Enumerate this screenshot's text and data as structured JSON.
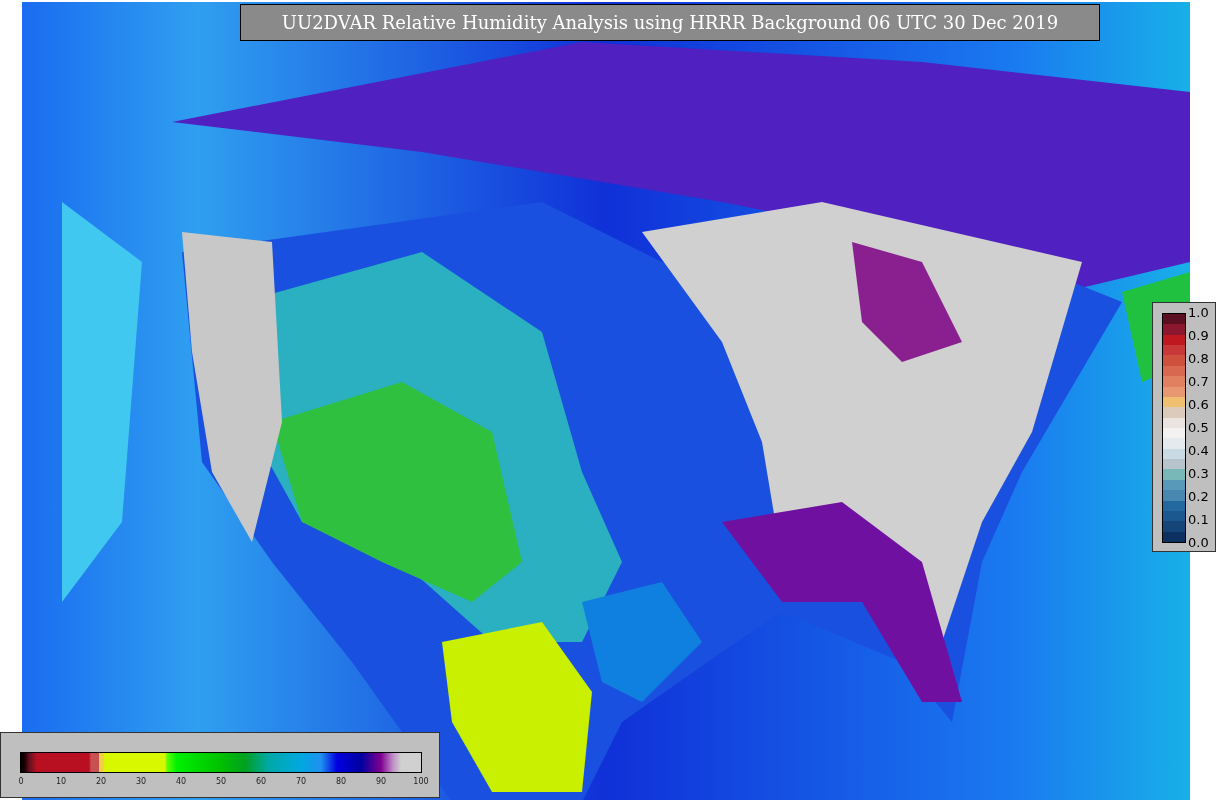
{
  "title": "UU2DVAR Relative Humidity Analysis using HRRR Background 06 UTC 30 Dec 2019",
  "weight_colorbar": {
    "ticks": [
      "1.0",
      "0.9",
      "0.8",
      "0.7",
      "0.6",
      "0.5",
      "0.4",
      "0.3",
      "0.2",
      "0.1",
      "0.0"
    ]
  },
  "humidity_colorbar": {
    "ticks": [
      "0",
      "10",
      "20",
      "30",
      "40",
      "50",
      "60",
      "70",
      "80",
      "90",
      "100"
    ]
  }
}
